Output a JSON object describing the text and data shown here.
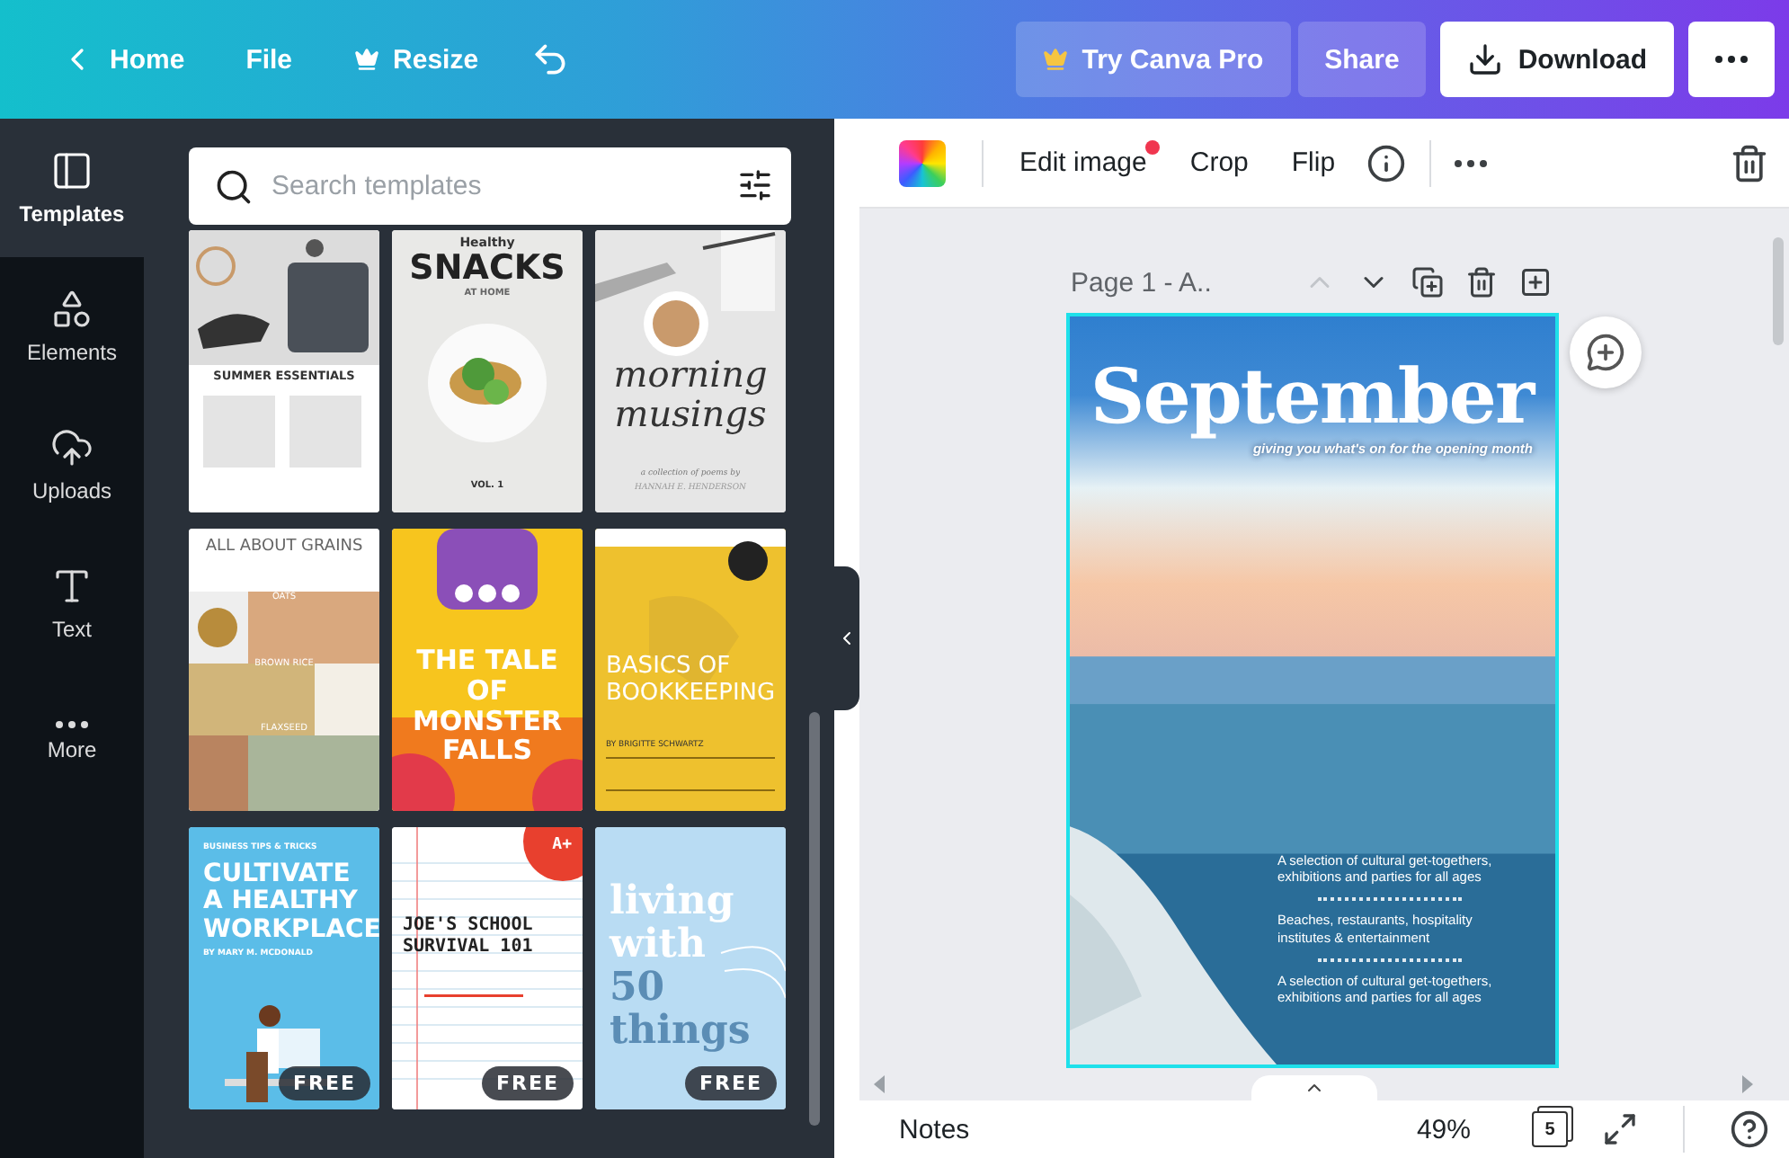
{
  "topbar": {
    "left": [
      {
        "kind": "back",
        "label": "Home"
      },
      {
        "kind": "plain",
        "label": "File"
      },
      {
        "kind": "crown",
        "label": "Resize"
      },
      {
        "kind": "undo"
      }
    ],
    "right": [
      {
        "kind": "pro",
        "label": "Try Canva Pro"
      },
      {
        "kind": "plain",
        "label": "Share"
      },
      {
        "kind": "download",
        "label": "Download"
      },
      {
        "kind": "more"
      }
    ]
  },
  "rail": [
    {
      "kind": "templates",
      "label": "Templates",
      "selected": true
    },
    {
      "kind": "elements",
      "label": "Elements",
      "selected": false
    },
    {
      "kind": "uploads",
      "label": "Uploads",
      "selected": false
    },
    {
      "kind": "text",
      "label": "Text",
      "selected": false
    },
    {
      "kind": "more",
      "label": "More",
      "selected": false
    }
  ],
  "search": {
    "placeholder": "Search templates"
  },
  "templates": [
    {
      "kind": "essentials",
      "texts": [
        "SUMMER ESSENTIALS"
      ],
      "free": false
    },
    {
      "kind": "snacks",
      "texts": [
        "Healthy",
        "SNACKS",
        "AT HOME",
        "VOL. 1"
      ],
      "free": false
    },
    {
      "kind": "musings",
      "texts": [
        "morning",
        "musings",
        "a collection of poems by",
        "HANNAH E. HENDERSON"
      ],
      "free": false
    },
    {
      "kind": "grains",
      "texts": [
        "ALL ABOUT GRAINS",
        "OATS",
        "BROWN RICE",
        "FLAXSEED"
      ],
      "free": false
    },
    {
      "kind": "monster",
      "texts": [
        "THE TALE",
        "OF",
        "MONSTER",
        "FALLS"
      ],
      "free": false
    },
    {
      "kind": "bookkeeping",
      "texts": [
        "BASICS OF",
        "BOOKKEEPING",
        "BY BRIGITTE SCHWARTZ"
      ],
      "free": false
    },
    {
      "kind": "workplace",
      "texts": [
        "BUSINESS TIPS & TRICKS",
        "CULTIVATE",
        "A HEALTHY",
        "WORKPLACE",
        "BY MARY M. MCDONALD"
      ],
      "free": true,
      "badge": "FREE"
    },
    {
      "kind": "school",
      "texts": [
        "A+",
        "JOE'S SCHOOL",
        "SURVIVAL 101"
      ],
      "free": true,
      "badge": "FREE"
    },
    {
      "kind": "living",
      "texts": [
        "living",
        "with",
        "50",
        "things"
      ],
      "free": true,
      "badge": "FREE"
    }
  ],
  "toolbar": [
    {
      "kind": "color"
    },
    {
      "kind": "text",
      "label": "Edit image",
      "notify": true
    },
    {
      "kind": "text",
      "label": "Crop",
      "notify": false
    },
    {
      "kind": "text",
      "label": "Flip",
      "notify": false
    },
    {
      "kind": "info"
    },
    {
      "kind": "more"
    },
    {
      "kind": "delete"
    }
  ],
  "page": {
    "label": "Page 1 - A..",
    "actions": [
      {
        "kind": "up",
        "disabled": true
      },
      {
        "kind": "down",
        "disabled": false
      },
      {
        "kind": "duplicate",
        "disabled": false
      },
      {
        "kind": "delete",
        "disabled": false
      },
      {
        "kind": "add",
        "disabled": false
      }
    ],
    "design": {
      "title": "September",
      "subtitle": "giving you what's on for the opening month",
      "blocks": [
        "A selection of cultural get-togethers, exhibitions and parties for all ages",
        "Beaches, restaurants, hospitality institutes & entertainment",
        "A selection of cultural get-togethers, exhibitions and parties for all ages"
      ]
    }
  },
  "footer": {
    "notes": "Notes",
    "zoom": "49%",
    "pages": "5"
  }
}
